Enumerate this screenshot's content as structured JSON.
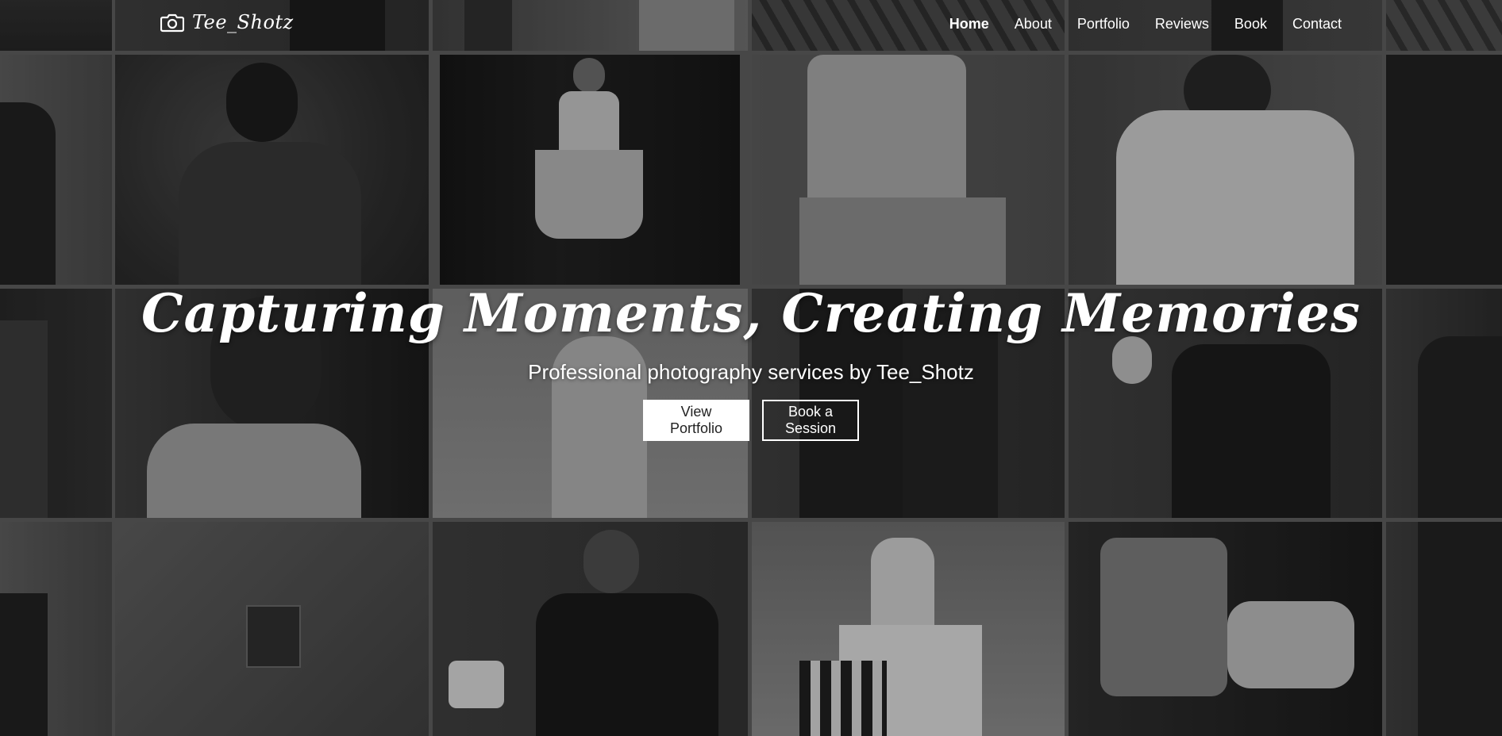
{
  "brand": {
    "name": "Tee_Shotz",
    "icon": "camera-icon"
  },
  "nav": {
    "items": [
      {
        "label": "Home",
        "active": true
      },
      {
        "label": "About",
        "active": false
      },
      {
        "label": "Portfolio",
        "active": false
      },
      {
        "label": "Reviews",
        "active": false
      },
      {
        "label": "Book",
        "active": false
      },
      {
        "label": "Contact",
        "active": false
      }
    ]
  },
  "hero": {
    "title": "Capturing Moments, Creating Memories",
    "subtitle": "Professional photography services by Tee_Shotz",
    "primary_button": "View Portfolio",
    "secondary_button": "Book a Session"
  },
  "colors": {
    "text": "#ffffff",
    "primary_button_bg": "#ffffff",
    "primary_button_text": "#222222",
    "gap": "#5a5a5a"
  }
}
